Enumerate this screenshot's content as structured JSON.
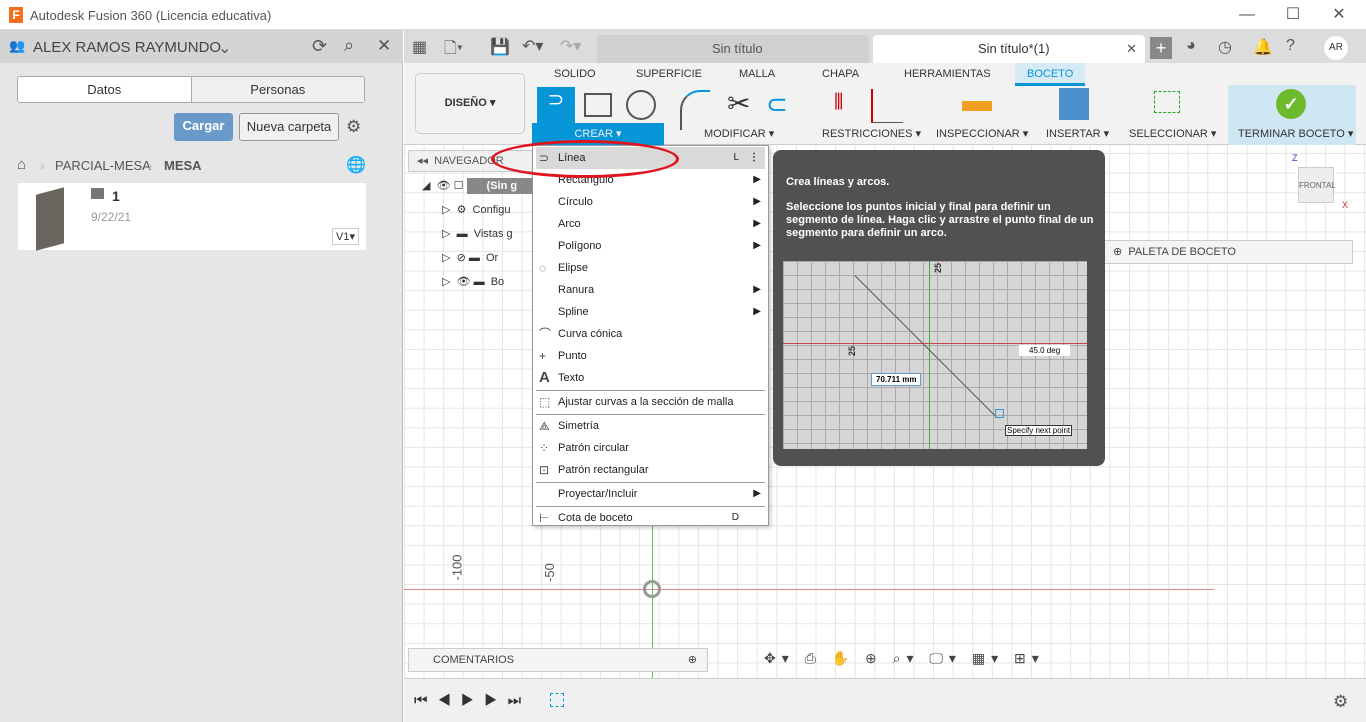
{
  "window": {
    "title": "Autodesk Fusion 360 (Licencia educativa)",
    "logo": "F"
  },
  "left_panel": {
    "user": "ALEX RAMOS RAYMUNDO",
    "tabs": [
      "Datos",
      "Personas"
    ],
    "upload": "Cargar",
    "new_folder": "Nueva carpeta",
    "breadcrumb": [
      "PARCIAL-MESA",
      "MESA"
    ],
    "file": {
      "name": "1",
      "date": "9/22/21",
      "version": "V1"
    }
  },
  "doc_tabs": [
    {
      "label": "Sin título"
    },
    {
      "label": "Sin título*(1)"
    }
  ],
  "avatar": "AR",
  "ribbon": {
    "workspace": "DISEÑO",
    "tabs": [
      "SOLIDO",
      "SUPERFICIE",
      "MALLA",
      "CHAPA",
      "HERRAMIENTAS",
      "BOCETO"
    ],
    "active_tab": "BOCETO",
    "groups": [
      "CREAR",
      "MODIFICAR",
      "RESTRICCIONES",
      "INSPECCIONAR",
      "INSERTAR",
      "SELECCIONAR",
      "TERMINAR BOCETO"
    ]
  },
  "navigator": {
    "title": "NAVEGADOR",
    "items": [
      "(Sin g",
      "Configu",
      "Vistas g",
      "Or",
      "Bo"
    ]
  },
  "sketch_palette": "PALETA DE BOCETO",
  "viewcube": {
    "face": "FRONTAL",
    "z": "Z",
    "x": "X"
  },
  "axis_labels": [
    "-100",
    "-50"
  ],
  "comments": "COMENTARIOS",
  "create_menu": {
    "items": [
      {
        "label": "Línea",
        "shortcut": "L"
      },
      {
        "label": "Rectángulo",
        "sub": true
      },
      {
        "label": "Círculo",
        "sub": true
      },
      {
        "label": "Arco",
        "sub": true
      },
      {
        "label": "Polígono",
        "sub": true
      },
      {
        "label": "Elipse"
      },
      {
        "label": "Ranura",
        "sub": true
      },
      {
        "label": "Spline",
        "sub": true
      },
      {
        "label": "Curva cónica"
      },
      {
        "label": "Punto"
      },
      {
        "label": "Texto"
      },
      {
        "label": "Ajustar curvas a la sección de malla"
      },
      {
        "label": "Simetría"
      },
      {
        "label": "Patrón circular"
      },
      {
        "label": "Patrón rectangular"
      },
      {
        "label": "Proyectar/Incluir",
        "sub": true
      },
      {
        "label": "Cota de boceto",
        "shortcut": "D"
      }
    ]
  },
  "tooltip": {
    "title": "Crea líneas y arcos.",
    "body": "Seleccione los puntos inicial y final para definir un segmento de línea. Haga clic y arrastre el punto final de un segmento para definir un arco.",
    "image": {
      "length": "70.711 mm",
      "angle": "45.0 deg",
      "prompt": "Specify next point",
      "tick1": "25",
      "tick2": "25"
    }
  },
  "colors": {
    "accent": "#0696d7",
    "highlight_circle": "#e0141e",
    "finish": "#6cbb2b"
  }
}
